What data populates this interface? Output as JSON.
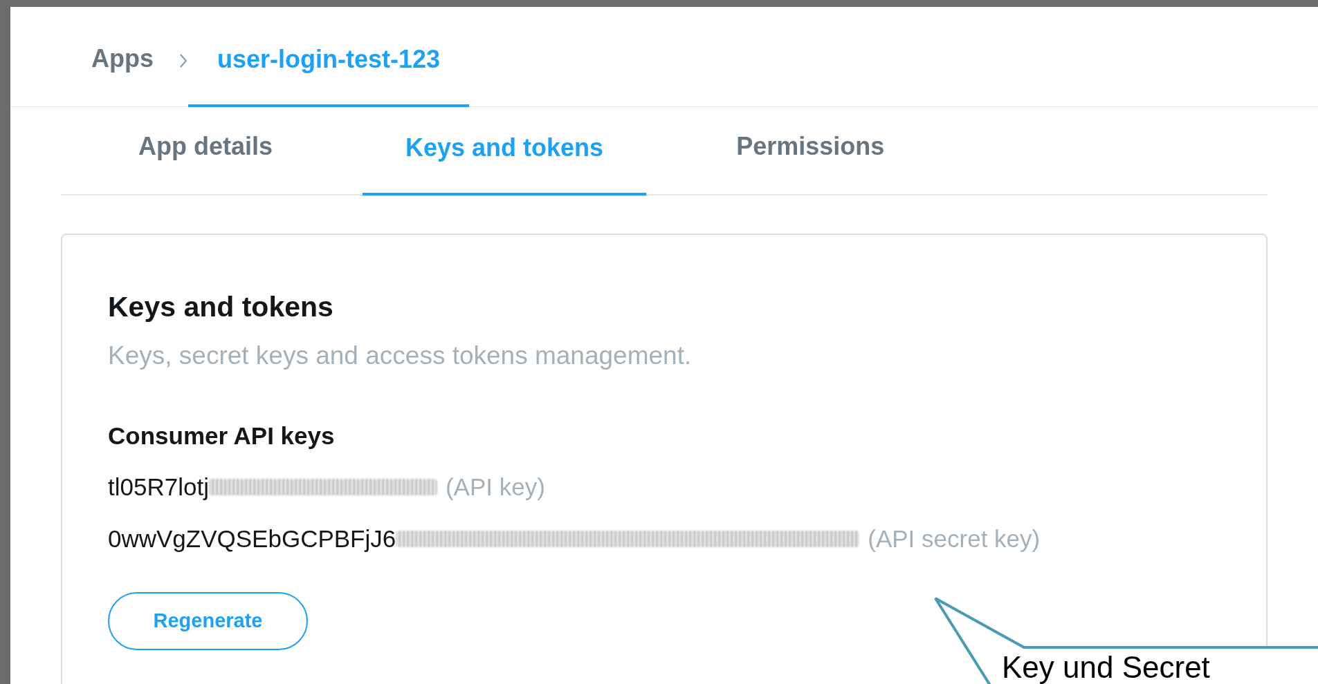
{
  "breadcrumb": [
    {
      "label": "Apps",
      "selected": false
    },
    {
      "label": "user-login-test-123",
      "selected": true
    }
  ],
  "tabs": [
    {
      "label": "App details",
      "selected": false
    },
    {
      "label": "Keys and tokens",
      "selected": true
    },
    {
      "label": "Permissions",
      "selected": false
    }
  ],
  "card": {
    "title": "Keys and tokens",
    "subtitle": "Keys, secret keys and access tokens management.",
    "section_title": "Consumer API keys",
    "keys": [
      {
        "value": "tl05R7lotj",
        "redacted": true,
        "label": "(API key)"
      },
      {
        "value": "0wwVgZVQSEbGCPBFjJ6",
        "redacted": true,
        "label": "(API secret key)"
      }
    ],
    "button": "Regenerate"
  },
  "callout": {
    "text": "Key und Secret"
  }
}
